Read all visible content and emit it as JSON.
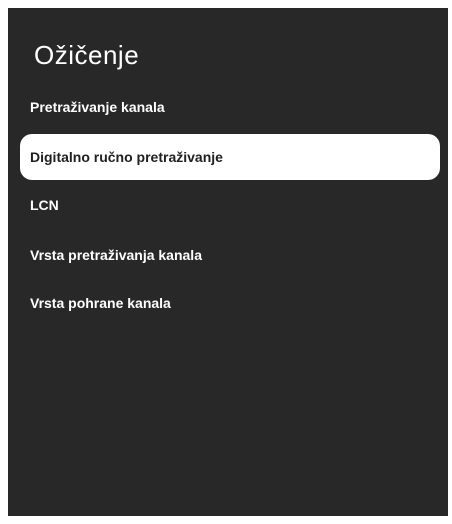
{
  "screen": {
    "title": "Ožičenje"
  },
  "menu": {
    "selected_index": 1,
    "items": [
      {
        "label": "Pretraživanje kanala"
      },
      {
        "label": "Digitalno ručno pretraživanje"
      },
      {
        "label": "LCN"
      },
      {
        "label": "Vrsta pretraživanja kanala"
      },
      {
        "label": "Vrsta pohrane kanala"
      }
    ]
  },
  "colors": {
    "panel_background": "#282828",
    "text": "#ffffff",
    "selected_background": "#ffffff",
    "selected_text": "#202020"
  }
}
